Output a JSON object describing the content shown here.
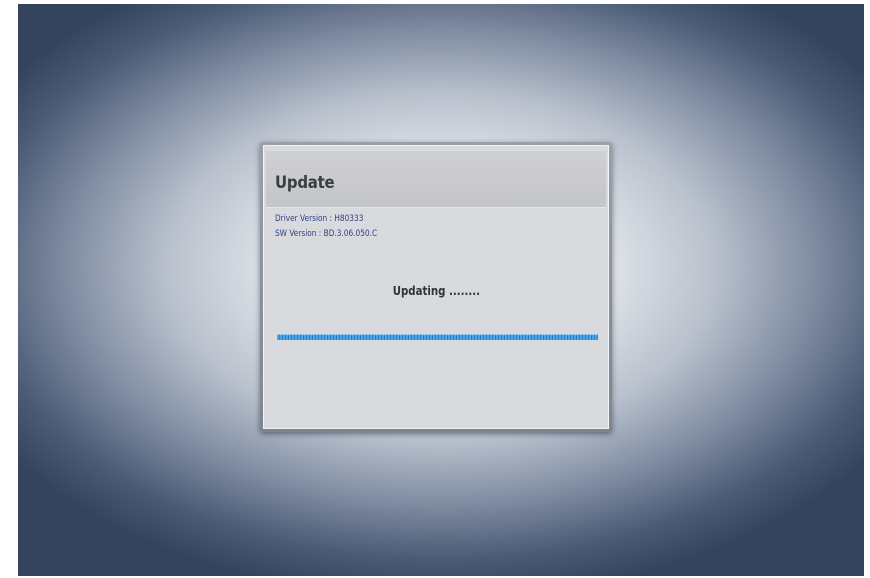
{
  "dialog": {
    "title": "Update",
    "driver_version_line": "Driver Version : H80333",
    "sw_version_line": "SW Version : BD.3.06.050.C",
    "status": "Updating ........",
    "progress": 1.0
  },
  "colors": {
    "info_text": "#2e3f86",
    "progress_fill": "#4aa6e8",
    "progress_track": "#1f2328"
  }
}
